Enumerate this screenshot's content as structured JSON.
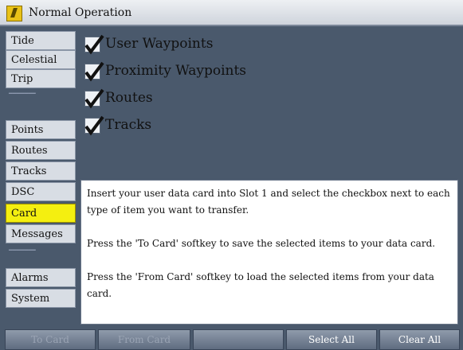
{
  "window": {
    "title": "Normal Operation"
  },
  "sidebar": {
    "items": [
      {
        "label": "Tide"
      },
      {
        "label": "Celestial"
      },
      {
        "label": "Trip"
      },
      {
        "label": "Points"
      },
      {
        "label": "Routes"
      },
      {
        "label": "Tracks"
      },
      {
        "label": "DSC"
      },
      {
        "label": "Card",
        "selected": true
      },
      {
        "label": "Messages"
      },
      {
        "label": "Alarms"
      },
      {
        "label": "System"
      }
    ]
  },
  "options": [
    {
      "label": "User Waypoints",
      "checked": true
    },
    {
      "label": "Proximity Waypoints",
      "checked": true
    },
    {
      "label": "Routes",
      "checked": true
    },
    {
      "label": "Tracks",
      "checked": true
    }
  ],
  "info": {
    "paragraphs": [
      "Insert your user data card into Slot 1 and select the checkbox next to each type of item you want to transfer.",
      "Press the 'To Card' softkey to save the selected items to your data card.",
      "Press the 'From Card' softkey to load the selected items from your data card."
    ]
  },
  "softkeys": [
    {
      "label": "To Card",
      "enabled": false
    },
    {
      "label": "From Card",
      "enabled": false
    },
    {
      "label": "",
      "enabled": false
    },
    {
      "label": "Select All",
      "enabled": true
    },
    {
      "label": "Clear All",
      "enabled": true
    }
  ],
  "colors": {
    "selected": "#f4ef10",
    "background": "#4a596c",
    "panel": "#d8dde4"
  }
}
